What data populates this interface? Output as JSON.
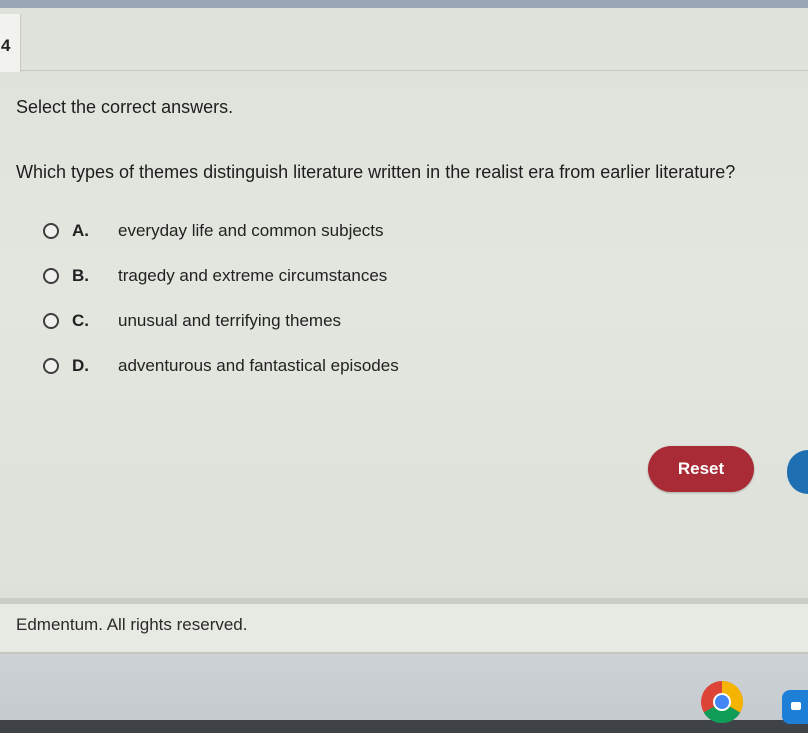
{
  "question_number": "4",
  "instruction": "Select the correct answers.",
  "question": "Which types of themes distinguish literature written in the realist era from earlier literature?",
  "options": [
    {
      "letter": "A.",
      "text": "everyday life and common subjects"
    },
    {
      "letter": "B.",
      "text": "tragedy and extreme circumstances"
    },
    {
      "letter": "C.",
      "text": "unusual and terrifying themes"
    },
    {
      "letter": "D.",
      "text": "adventurous and fantastical episodes"
    }
  ],
  "reset_label": "Reset",
  "footer": {
    "copyright": "Edmentum. All rights reserved."
  },
  "colors": {
    "reset_button": "#a82b35",
    "side_button": "#1f6fb3"
  },
  "taskbar": {
    "icons": [
      "chrome-icon",
      "files-icon"
    ]
  }
}
